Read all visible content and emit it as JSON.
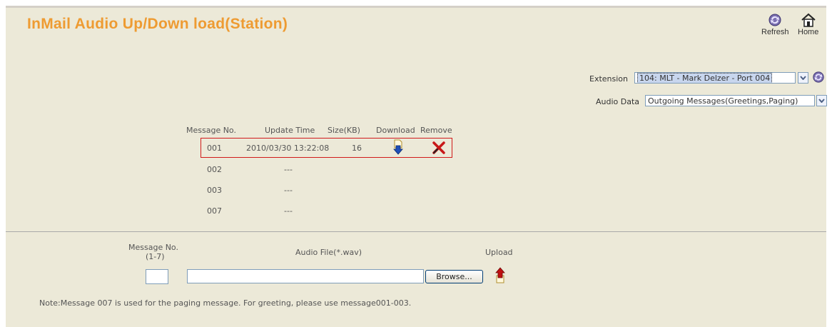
{
  "page": {
    "title": "InMail Audio Up/Down load(Station)"
  },
  "toolbar": {
    "refresh_label": "Refresh",
    "home_label": "Home"
  },
  "filters": {
    "extension_label": "Extension",
    "extension_value": "104: MLT - Mark Delzer - Port 004",
    "audio_data_label": "Audio Data",
    "audio_data_value": "Outgoing Messages(Greetings,Paging)"
  },
  "table": {
    "headers": {
      "message_no": "Message No.",
      "update_time": "Update Time",
      "size": "Size(KB)",
      "download": "Download",
      "remove": "Remove"
    },
    "rows": [
      {
        "message_no": "001",
        "update_time": "2010/03/30 13:22:08",
        "size": "16",
        "has_file": true
      },
      {
        "message_no": "002",
        "update_time": "---",
        "size": "",
        "has_file": false
      },
      {
        "message_no": "003",
        "update_time": "---",
        "size": "",
        "has_file": false
      },
      {
        "message_no": "007",
        "update_time": "---",
        "size": "",
        "has_file": false
      }
    ]
  },
  "upload": {
    "message_no_label": "Message No.",
    "message_no_range": "(1-7)",
    "message_no_value": "",
    "audio_file_label": "Audio File(*.wav)",
    "audio_file_value": "",
    "browse_label": "Browse...",
    "upload_label": "Upload"
  },
  "note": "Note:Message 007 is used for the paging message. For greeting, please use message001-003.",
  "colors": {
    "title": "#ee9b32",
    "panel": "#ece9d8",
    "highlight_border": "#d11a1a"
  }
}
